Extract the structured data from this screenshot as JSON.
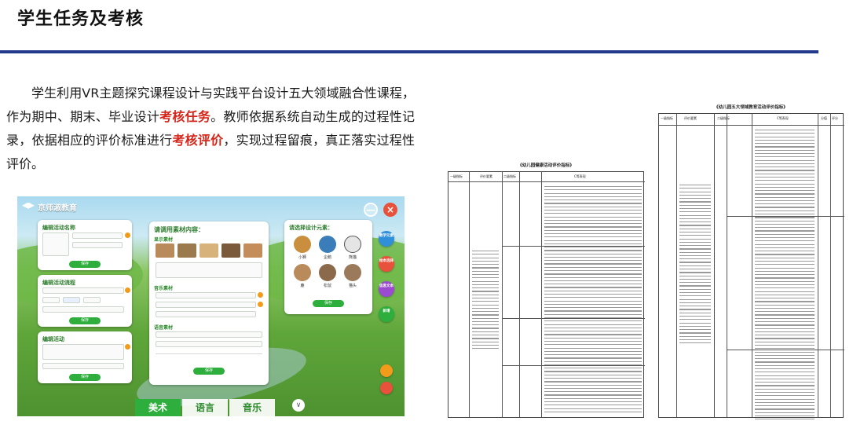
{
  "header": {
    "title": "学生任务及考核",
    "rule_color": "#233a8c"
  },
  "intro": {
    "part1": "学生利用VR主题探究课程设计与实践平台设计五大领域融合性课程，作为期中、期末、毕业设计",
    "highlight1": "考核任务",
    "part2": "。教师依据系统自动生成的过程性记录，依据相应的评价标准进行",
    "highlight2": "考核评价",
    "part3": "，实现过程留痕，真正落实过程性评价。",
    "highlight_color": "#d62418"
  },
  "vr_app": {
    "logo_text": "京师淑教育",
    "minimize_label": "—",
    "close_label": "×",
    "center_panel_title": "请调用素材内容：",
    "center_section1": "显示素材",
    "center_section2": "音乐素材",
    "center_section3": "语音素材",
    "center_button": "保存",
    "right_panel_title": "请选择设计元素：",
    "right_button": "保存",
    "right_items": [
      "小狮",
      "企鹅",
      "熊猫",
      "鹿",
      "松鼠",
      "猫头"
    ],
    "side_buttons": [
      "教学元素",
      "绘本选择",
      "信息文本",
      "新增"
    ],
    "bottom_tabs": [
      "美术",
      "语言",
      "音乐"
    ],
    "active_tab": "美术",
    "chevron": "∨",
    "left_card1_title": "编辑活动名称",
    "left_card2_title": "编辑活动流程",
    "left_card3_title": "编辑活动",
    "left_button": "保存"
  },
  "doc1": {
    "title": "《幼儿园健康活动评价指标》",
    "headers": [
      "一级指标",
      "评价要素",
      "二级指标",
      "C等表现"
    ]
  },
  "doc2": {
    "title": "《幼儿园五大领域教育活动评价指标》",
    "headers": [
      "一级指标",
      "评价要素",
      "二级指标",
      "C等表现",
      "分值",
      "评分"
    ]
  },
  "colors": {
    "accent_green": "#2eae3c",
    "orange": "#f29a1a",
    "close_red": "#e8523c"
  }
}
